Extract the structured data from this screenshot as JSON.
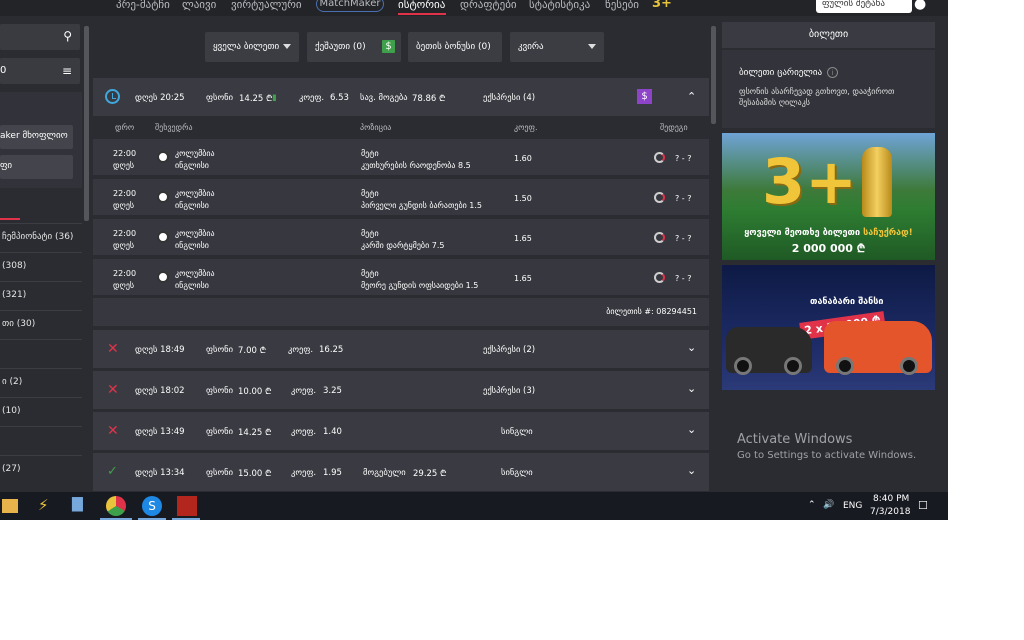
{
  "nav": {
    "items": [
      "პრე-მატჩი",
      "ლაივი",
      "ვირტუალური",
      "MatchMaker",
      "ისტორია",
      "დრაფტები",
      "სტატისტიკა",
      "წესები"
    ],
    "promo": "3+",
    "user_button": "ფულის შეტანა"
  },
  "sidebar": {
    "filter_value": "0",
    "buttons": [
      "aker მხოფლიო",
      "ფი"
    ],
    "items": [
      "ჩემპიონატი (36)",
      "(308)",
      "(321)",
      "თი (30)",
      "",
      "ი (2)",
      "(10)",
      "",
      "(27)"
    ]
  },
  "filters": {
    "all_tickets": "ყველა ბილეთი",
    "cashout": "ქეშაუთი (0)",
    "bonus": "ბეთის ბონუსი (0)",
    "week": "კვირა"
  },
  "open_ticket": {
    "time": "დღეს 20:25",
    "stake_label": "ფსონი",
    "stake": "14.25 ₾",
    "odds_label": "კოეფ.",
    "odds": "6.53",
    "potential_label": "სავ. მოგება",
    "potential": "78.86 ₾",
    "type": "ექსპრესი (4)",
    "columns": [
      "დრო",
      "შეხვედრა",
      "პოზიცია",
      "კოეფ.",
      "შედეგი"
    ],
    "selections": [
      {
        "time": "22:00",
        "day": "დღეს",
        "home": "კოლუმბია",
        "away": "ინგლისი",
        "market": "მეტი",
        "selection": "კუთხურების რაოდენობა 8.5",
        "odd": "1.60",
        "score": "? - ?"
      },
      {
        "time": "22:00",
        "day": "დღეს",
        "home": "კოლუმბია",
        "away": "ინგლისი",
        "market": "მეტი",
        "selection": "პირველი გუნდის ბარათები 1.5",
        "odd": "1.50",
        "score": "? - ?"
      },
      {
        "time": "22:00",
        "day": "დღეს",
        "home": "კოლუმბია",
        "away": "ინგლისი",
        "market": "მეტი",
        "selection": "კარში დარტყმები 7.5",
        "odd": "1.65",
        "score": "? - ?"
      },
      {
        "time": "22:00",
        "day": "დღეს",
        "home": "კოლუმბია",
        "away": "ინგლისი",
        "market": "მეტი",
        "selection": "მეორე გუნდის ოფსაიდები 1.5",
        "odd": "1.65",
        "score": "? - ?"
      }
    ],
    "ticket_number": "ბილეთის #: 08294451"
  },
  "history": [
    {
      "time": "დღეს 18:49",
      "stake": "7.00 ₾",
      "odds": "16.25",
      "win_label": "",
      "win": "",
      "type": "ექსპრესი (2)",
      "status": "lost"
    },
    {
      "time": "დღეს 18:02",
      "stake": "10.00 ₾",
      "odds": "3.25",
      "win_label": "",
      "win": "",
      "type": "ექსპრესი (3)",
      "status": "lost"
    },
    {
      "time": "დღეს 13:49",
      "stake": "14.25 ₾",
      "odds": "1.40",
      "win_label": "",
      "win": "",
      "type": "სინგლი",
      "status": "lost"
    },
    {
      "time": "დღეს 13:34",
      "stake": "15.00 ₾",
      "odds": "1.95",
      "win_label": "მოგებული",
      "win": "29.25 ₾",
      "type": "სინგლი",
      "status": "won"
    }
  ],
  "right_panel": {
    "title": "ბილეთი",
    "empty_title": "ბილეთი ცარიელია",
    "empty_text": "ფსონის ასარჩევად გთხოვთ, დააჭიროთ შესაბამის ღილაკს",
    "banner1_number": "3+",
    "banner1_line1_a": "ყოველი მეოთხე ბილეთი ",
    "banner1_line1_b": "საჩუქრად!",
    "banner1_line2": "2 000 000 ₾",
    "banner2_line1": "თანაბარი შანსი",
    "banner2_line2": "2 x 10 000 ₾"
  },
  "watermark": {
    "line1": "Activate Windows",
    "line2": "Go to Settings to activate Windows."
  },
  "taskbar": {
    "lang": "ENG",
    "time": "8:40 PM",
    "date": "7/3/2018"
  },
  "colors": {
    "accent": "#e0334a",
    "win": "#3ea04a",
    "clock": "#3fa8de",
    "bg": "#2b2c31"
  }
}
